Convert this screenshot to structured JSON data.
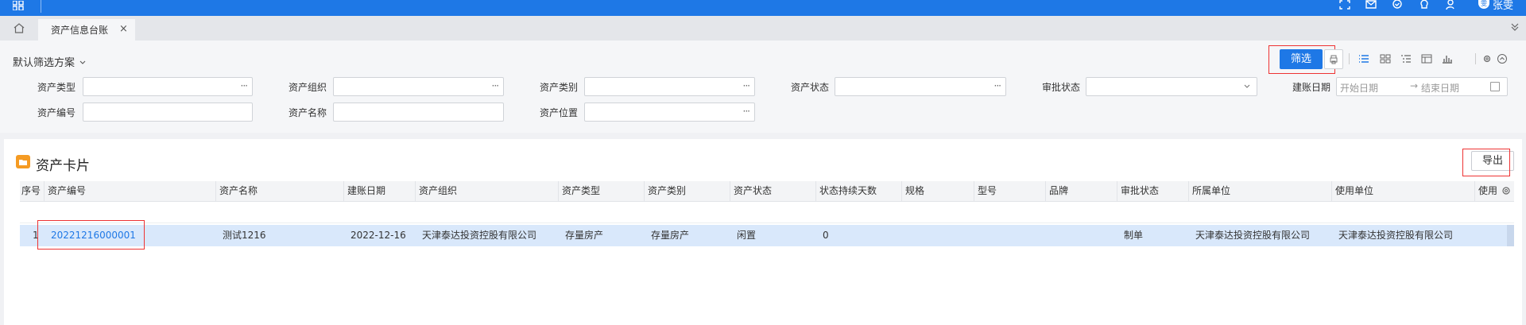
{
  "topbar": {
    "username": "张雯",
    "avatar_text": "雯",
    "icons": [
      "apps-grid-icon",
      "fullscreen-icon",
      "mail-icon",
      "check-circle-icon",
      "lightbulb-icon",
      "user-settings-icon"
    ]
  },
  "tabs": {
    "active_label": "资产信息台账",
    "close_glyph": "×"
  },
  "filter": {
    "scheme_label": "默认筛选方案",
    "fields": {
      "asset_type": "资产类型",
      "asset_org": "资产组织",
      "asset_category": "资产类别",
      "asset_status": "资产状态",
      "approval_status": "审批状态",
      "account_date": "建账日期",
      "asset_code": "资产编号",
      "asset_name": "资产名称",
      "asset_location": "资产位置"
    },
    "date_start_placeholder": "开始日期",
    "date_arrow": "→",
    "date_end_placeholder": "结束日期",
    "dots": "···",
    "filter_button": "筛选"
  },
  "card": {
    "title": "资产卡片",
    "export_button": "导出"
  },
  "table": {
    "headers": [
      "序号",
      "资产编号",
      "资产名称",
      "建账日期",
      "资产组织",
      "资产类型",
      "资产类别",
      "资产状态",
      "状态持续天数",
      "规格",
      "型号",
      "品牌",
      "审批状态",
      "所属单位",
      "使用单位",
      "使用"
    ],
    "rows": [
      {
        "index": "1",
        "code": "20221216000001",
        "name": "测试1216",
        "date": "2022-12-16",
        "org": "天津泰达投资控股有限公司",
        "type": "存量房产",
        "category": "存量房产",
        "status": "闲置",
        "days": "0",
        "spec": "",
        "model": "",
        "brand": "",
        "approval": "制单",
        "owner_unit": "天津泰达投资控股有限公司",
        "user_unit": "天津泰达投资控股有限公司"
      }
    ]
  },
  "colors": {
    "primary": "#1e78e6",
    "row_selected": "#d9e8fb",
    "card_icon": "#f59b23",
    "highlight_box": "#ee3333"
  }
}
